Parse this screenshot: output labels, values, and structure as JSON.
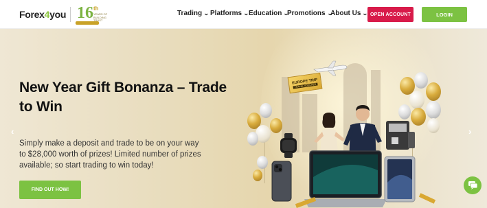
{
  "header": {
    "logo_prefix": "Forex",
    "logo_four": "4",
    "logo_suffix": "you",
    "anniversary_number": "16",
    "anniversary_suffix": "th",
    "anniversary_caption": "YEARS OF BUILDING TRUST",
    "nav": [
      {
        "label": "Trading"
      },
      {
        "label": "Platforms"
      },
      {
        "label": "Education"
      },
      {
        "label": "Promotions"
      },
      {
        "label": "About Us"
      }
    ],
    "open_account_label": "OPEN ACCOUNT",
    "login_label": "LOGIN"
  },
  "hero": {
    "title": "New Year Gift Bonanza – Trade to Win",
    "description": "Simply make a deposit and trade to be on your way to $28,000 worth of prizes! Limited number of prizes available; so start trading to win today!",
    "cta_label": "FIND OUT HOW!",
    "voucher_title": "EUROPE TRIP",
    "voucher_subtitle": "TRAVEL VOUCHER"
  },
  "colors": {
    "accent_green": "#7cc242",
    "open_account_red": "#d81b4a",
    "gold": "#c9a227"
  },
  "icons": {
    "prev": "chevron-left-icon",
    "next": "chevron-right-icon",
    "chat": "chat-bubble-icon",
    "nav_dropdown": "chevron-down-icon"
  }
}
